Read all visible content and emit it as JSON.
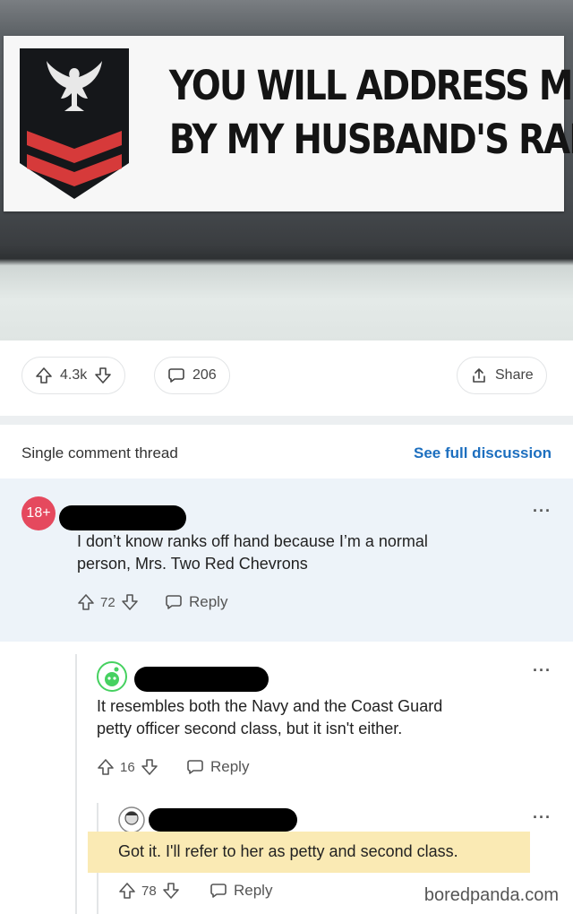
{
  "sticker": {
    "line1": "YOU WILL ADDRESS ME",
    "line2": "BY MY HUSBAND'S RANK",
    "colors": {
      "badge": "#15171a",
      "chevron": "#d63a3a",
      "eagle": "#e8e8e8"
    }
  },
  "post_actions": {
    "votes": "4.3k",
    "comments": "206",
    "share_label": "Share"
  },
  "thread": {
    "title": "Single comment thread",
    "see_full": "See full discussion"
  },
  "comments": [
    {
      "avatar_text": "18+",
      "line1": "I don’t know ranks off hand because I’m a normal",
      "line2": "person, Mrs. Two Red Chevrons",
      "votes": "72",
      "reply_label": "Reply",
      "more": "···"
    },
    {
      "line1": "It resembles both the Navy and the Coast Guard",
      "line2": "petty officer second class, but it isn't either.",
      "votes": "16",
      "reply_label": "Reply",
      "more": "···"
    },
    {
      "line1": "Got it. I'll refer to her as petty and second class.",
      "votes": "78",
      "reply_label": "Reply",
      "more": "···"
    }
  ],
  "watermark": "boredpanda.com",
  "colors": {
    "link": "#1d6fbf",
    "highlight": "#faeab4",
    "nsfw_avatar": "#e5495e",
    "avatar_green": "#46d160"
  }
}
